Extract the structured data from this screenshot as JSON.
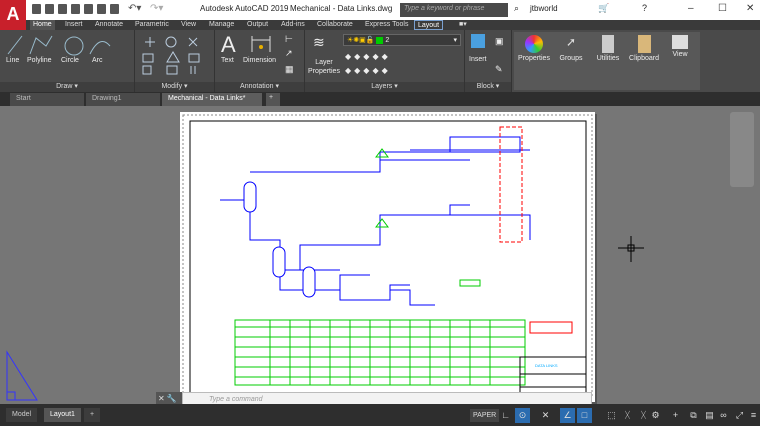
{
  "app": {
    "title": "Autodesk AutoCAD 2019",
    "file": "Mechanical - Data Links.dwg",
    "logo": "A"
  },
  "search": {
    "placeholder": "Type a keyword or phrase"
  },
  "user": {
    "name": "jtbworld"
  },
  "ribbon_tabs": [
    "Home",
    "Insert",
    "Annotate",
    "Parametric",
    "View",
    "Manage",
    "Output",
    "Add-ins",
    "Collaborate",
    "Express Tools",
    "Layout"
  ],
  "ribbon": {
    "draw": {
      "label": "Draw ▾",
      "tools": [
        "Line",
        "Polyline",
        "Circle",
        "Arc"
      ]
    },
    "modify": {
      "label": "Modify ▾"
    },
    "annotation": {
      "label": "Annotation ▾",
      "tools": [
        "Text",
        "Dimension"
      ]
    },
    "layers": {
      "label": "Layers ▾",
      "layer_properties": "Layer Properties",
      "current_layer": "2",
      "layer_color": "#00cc00"
    },
    "block": {
      "label": "Block ▾",
      "insert": "Insert"
    },
    "buttons": [
      "Properties",
      "Groups",
      "Utilities",
      "Clipboard",
      "View"
    ]
  },
  "doc_tabs": [
    "Start",
    "Drawing1",
    "Mechanical - Data Links*"
  ],
  "command": {
    "placeholder": "Type a command"
  },
  "layout_tabs": [
    "Model",
    "Layout1"
  ],
  "status": {
    "paper": "PAPER"
  },
  "colors": {
    "accent": "#c8202b",
    "drawing_blue": "#0000ff",
    "drawing_green": "#00cc00",
    "drawing_red": "#ff0000"
  }
}
